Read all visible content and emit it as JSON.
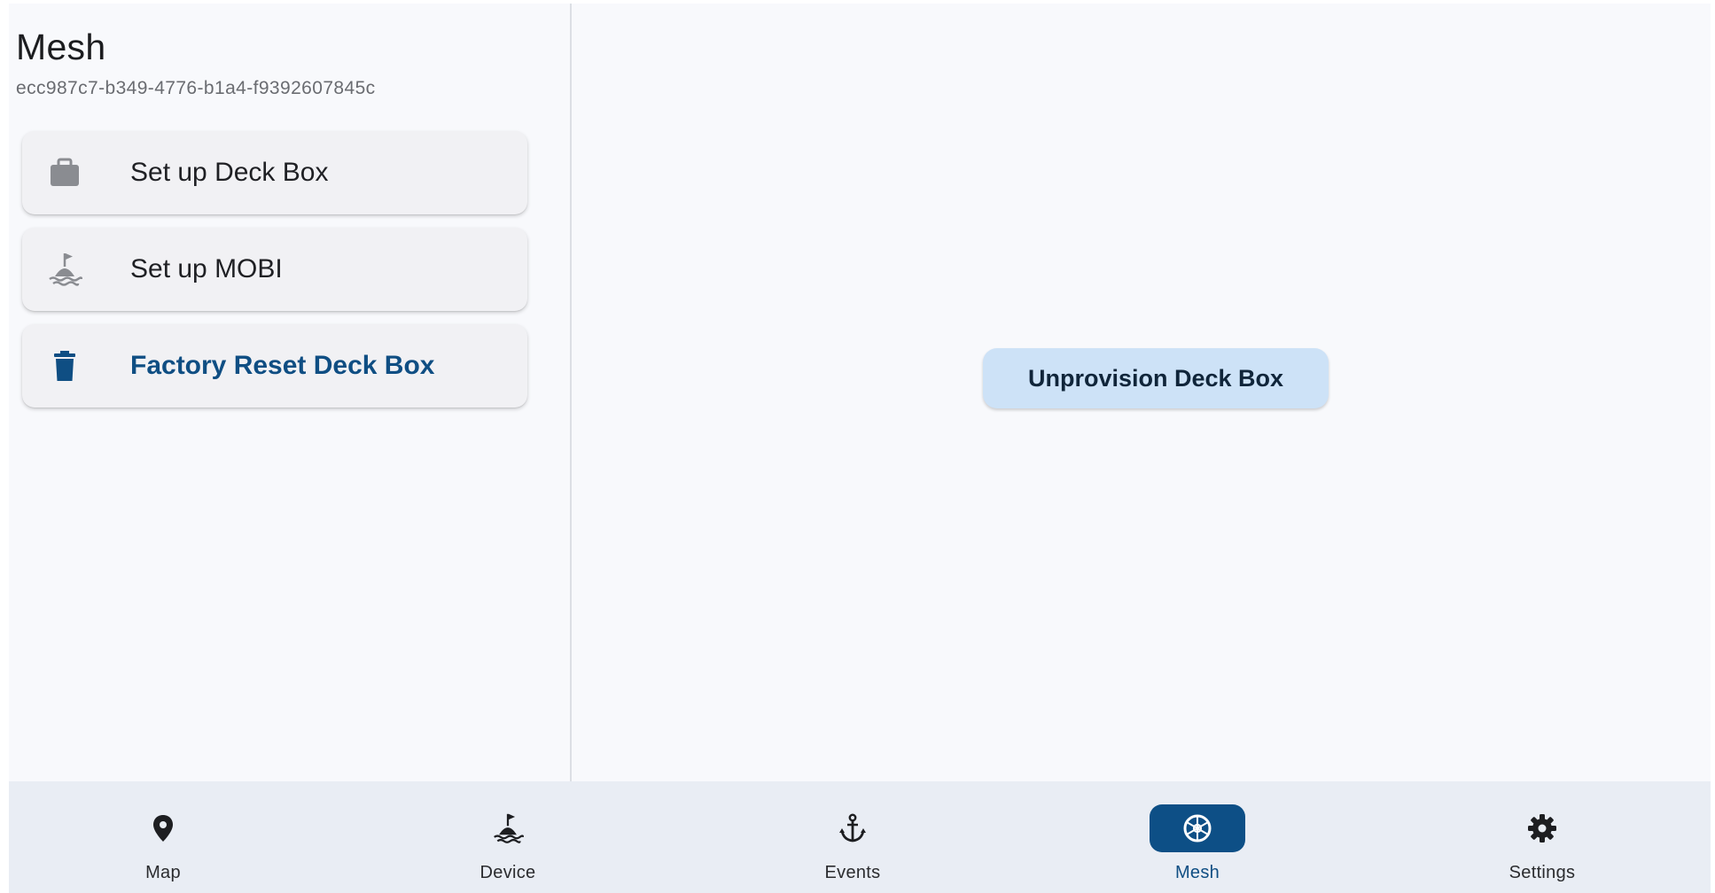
{
  "header": {
    "title": "Mesh",
    "mesh_id": "ecc987c7-b349-4776-b1a4-f9392607845c"
  },
  "menu": {
    "items": [
      {
        "label": "Set up Deck Box",
        "icon": "briefcase-icon"
      },
      {
        "label": "Set up MOBI",
        "icon": "buoy-icon"
      },
      {
        "label": "Factory Reset Deck Box",
        "icon": "trash-icon"
      }
    ]
  },
  "main": {
    "unprovision_label": "Unprovision Deck Box"
  },
  "bottom_nav": {
    "items": [
      {
        "label": "Map",
        "icon": "map-pin-icon",
        "active": false
      },
      {
        "label": "Device",
        "icon": "buoy-icon",
        "active": false
      },
      {
        "label": "Events",
        "icon": "anchor-icon",
        "active": false
      },
      {
        "label": "Mesh",
        "icon": "ship-wheel-icon",
        "active": true
      },
      {
        "label": "Settings",
        "icon": "gear-icon",
        "active": false
      }
    ]
  },
  "colors": {
    "accent": "#0f4e83",
    "accent_dark": "#0d4f86",
    "button_bg": "#cde2f7",
    "nav_bg": "#e9edf4",
    "page_bg": "#f8f9fc"
  }
}
